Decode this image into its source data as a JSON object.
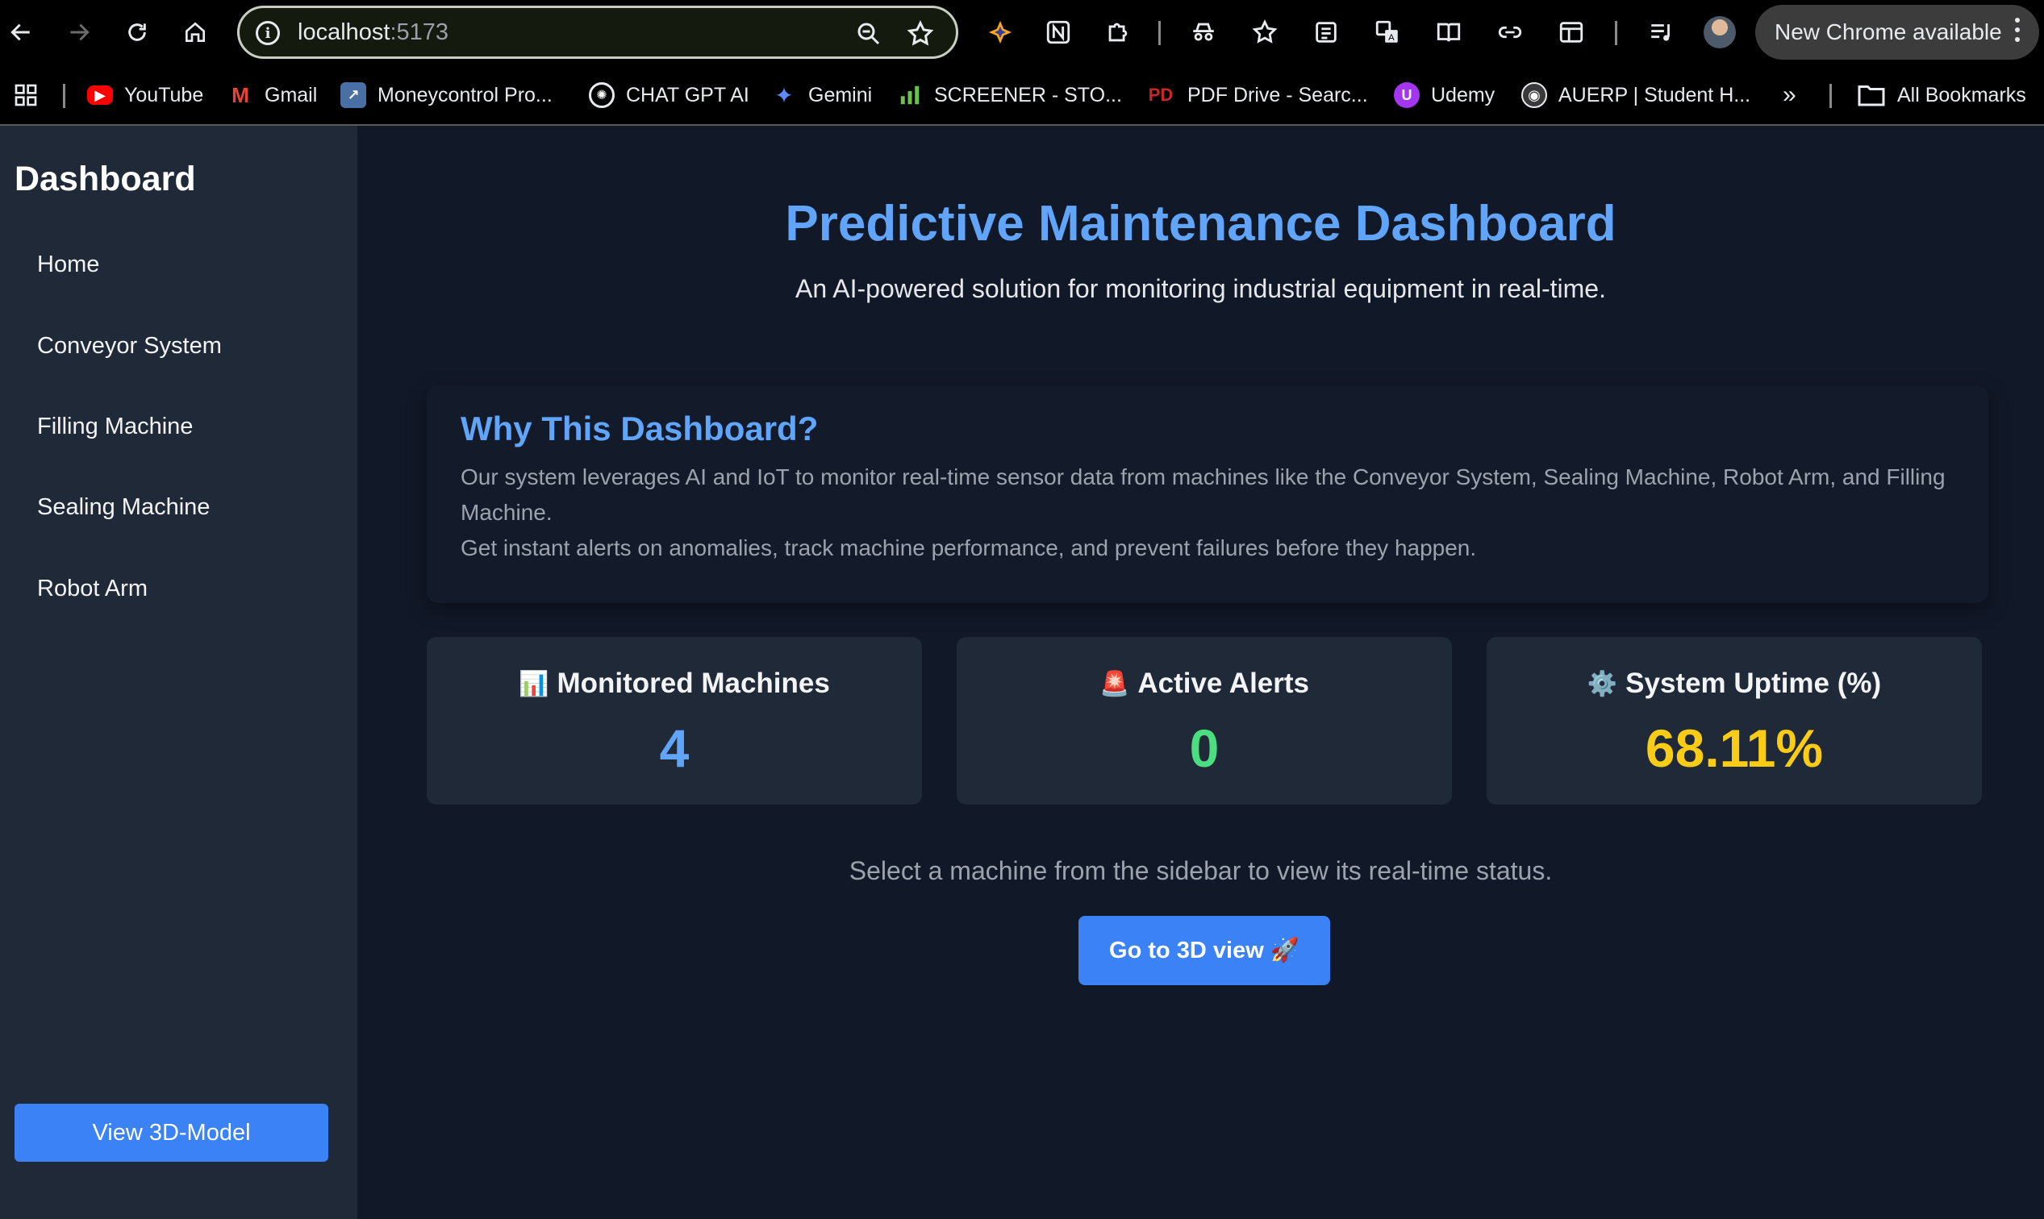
{
  "browser": {
    "url_host": "localhost",
    "url_port": ":5173",
    "update_label": "New Chrome available",
    "bookmarks": [
      {
        "label": "YouTube"
      },
      {
        "label": "Gmail"
      },
      {
        "label": "Moneycontrol Pro..."
      },
      {
        "label": "CHAT GPT AI"
      },
      {
        "label": "Gemini"
      },
      {
        "label": "SCREENER - STO..."
      },
      {
        "label": "PDF Drive - Searc..."
      },
      {
        "label": "Udemy"
      },
      {
        "label": "AUERP | Student H..."
      }
    ],
    "overflow_label": "»",
    "all_bookmarks": "All Bookmarks"
  },
  "sidebar": {
    "title": "Dashboard",
    "items": [
      {
        "label": "Home"
      },
      {
        "label": "Conveyor System"
      },
      {
        "label": "Filling Machine"
      },
      {
        "label": "Sealing Machine"
      },
      {
        "label": "Robot Arm"
      }
    ],
    "button_label": "View 3D-Model"
  },
  "main": {
    "title": "Predictive Maintenance Dashboard",
    "subtitle": "An AI-powered solution for monitoring industrial equipment in real-time.",
    "why": {
      "heading": "Why This Dashboard?",
      "paragraph1": "Our system leverages AI and IoT to monitor real-time sensor data from machines like the Conveyor System, Sealing Machine, Robot Arm, and Filling Machine.",
      "paragraph2": "Get instant alerts on anomalies, track machine performance, and prevent failures before they happen."
    },
    "stats": [
      {
        "icon": "📊",
        "label": "Monitored Machines",
        "value": "4",
        "color": "#60a5fa"
      },
      {
        "icon": "🚨",
        "label": "Active Alerts",
        "value": "0",
        "color": "#4ade80"
      },
      {
        "icon": "⚙️",
        "label": "System Uptime (%)",
        "value": "68.11%",
        "color": "#facc15"
      }
    ],
    "hint": "Select a machine from the sidebar to view its real-time status.",
    "go_button": "Go to 3D view 🚀"
  }
}
